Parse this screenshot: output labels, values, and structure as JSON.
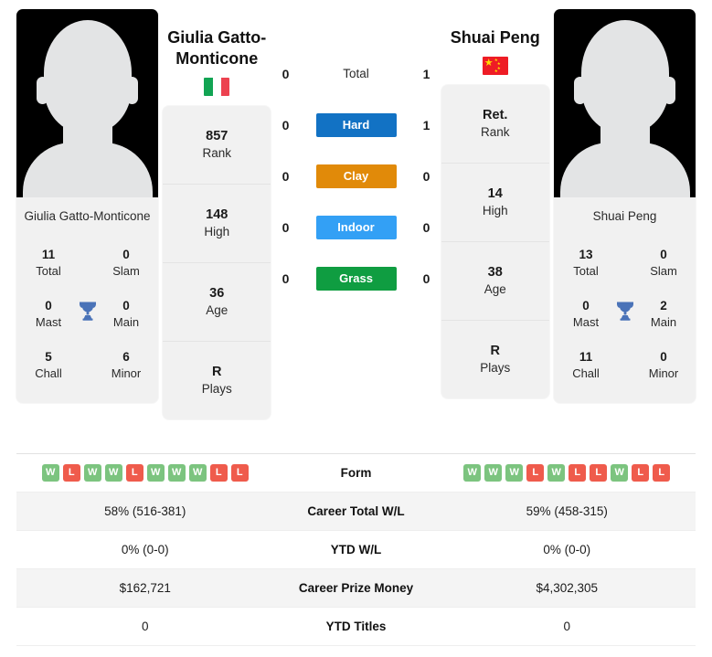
{
  "players": {
    "left": {
      "name": "Giulia Gatto-Monticone",
      "card_name": "Giulia Gatto-Monticone",
      "flag": "italy-flag-icon",
      "titles": {
        "total_val": "11",
        "total_lbl": "Total",
        "slam_val": "0",
        "slam_lbl": "Slam",
        "mast_val": "0",
        "mast_lbl": "Mast",
        "main_val": "0",
        "main_lbl": "Main",
        "chall_val": "5",
        "chall_lbl": "Chall",
        "minor_val": "6",
        "minor_lbl": "Minor"
      },
      "details": [
        {
          "value": "857",
          "label": "Rank"
        },
        {
          "value": "148",
          "label": "High"
        },
        {
          "value": "36",
          "label": "Age"
        },
        {
          "value": "R",
          "label": "Plays"
        }
      ],
      "form": [
        "W",
        "L",
        "W",
        "W",
        "L",
        "W",
        "W",
        "W",
        "L",
        "L"
      ],
      "career_wl": "58% (516-381)",
      "ytd_wl": "0% (0-0)",
      "prize_money": "$162,721",
      "ytd_titles": "0"
    },
    "right": {
      "name": "Shuai Peng",
      "card_name": "Shuai Peng",
      "flag": "china-flag-icon",
      "titles": {
        "total_val": "13",
        "total_lbl": "Total",
        "slam_val": "0",
        "slam_lbl": "Slam",
        "mast_val": "0",
        "mast_lbl": "Mast",
        "main_val": "2",
        "main_lbl": "Main",
        "chall_val": "11",
        "chall_lbl": "Chall",
        "minor_val": "0",
        "minor_lbl": "Minor"
      },
      "details": [
        {
          "value": "Ret.",
          "label": "Rank"
        },
        {
          "value": "14",
          "label": "High"
        },
        {
          "value": "38",
          "label": "Age"
        },
        {
          "value": "R",
          "label": "Plays"
        }
      ],
      "form": [
        "W",
        "W",
        "W",
        "L",
        "W",
        "L",
        "L",
        "W",
        "L",
        "L"
      ],
      "career_wl": "59% (458-315)",
      "ytd_wl": "0% (0-0)",
      "prize_money": "$4,302,305",
      "ytd_titles": "0"
    }
  },
  "h2h": {
    "rows": [
      {
        "label": "Total",
        "left": "0",
        "right": "1",
        "color": "none"
      },
      {
        "label": "Hard",
        "left": "0",
        "right": "1",
        "color": "#1272c4"
      },
      {
        "label": "Clay",
        "left": "0",
        "right": "0",
        "color": "#e18a09"
      },
      {
        "label": "Indoor",
        "left": "0",
        "right": "0",
        "color": "#33a0f5"
      },
      {
        "label": "Grass",
        "left": "0",
        "right": "0",
        "color": "#0f9d41"
      }
    ]
  },
  "stats_table": {
    "rows": [
      {
        "label": "Form",
        "type": "form"
      },
      {
        "label": "Career Total W/L",
        "type": "text",
        "key": "career_wl"
      },
      {
        "label": "YTD W/L",
        "type": "text",
        "key": "ytd_wl"
      },
      {
        "label": "Career Prize Money",
        "type": "text",
        "key": "prize_money"
      },
      {
        "label": "YTD Titles",
        "type": "text",
        "key": "ytd_titles"
      }
    ]
  },
  "colors": {
    "hard": "#1272c4",
    "clay": "#e18a09",
    "indoor": "#33a0f5",
    "grass": "#0f9d41",
    "win": "#7cc47f",
    "loss": "#ef5b4c",
    "trophy": "#4a73b8"
  }
}
